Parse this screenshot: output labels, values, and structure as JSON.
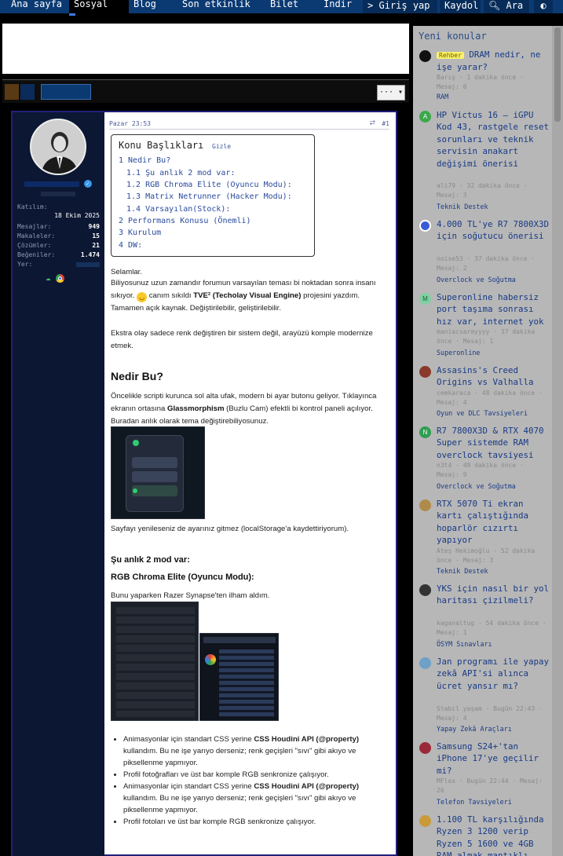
{
  "nav": {
    "home": "Ana sayfa",
    "social": "Sosyal",
    "blog": "Blog",
    "recent": "Son etkinlik",
    "ticket": "Bilet",
    "download": "İndir",
    "login": "Giriş yap",
    "register": "Kaydol",
    "search": "Ara"
  },
  "thread": {
    "more_label": "···"
  },
  "post": {
    "timestamp": "Pazar 23:53",
    "number": "#1",
    "author": {
      "joined_label": "Katılım:",
      "joined_value": "18 Ekim 2025",
      "stats": [
        {
          "label": "Mesajlar:",
          "value": "949"
        },
        {
          "label": "Makaleler:",
          "value": "15"
        },
        {
          "label": "Çözümler:",
          "value": "21"
        },
        {
          "label": "Beğeniler:",
          "value": "1.474"
        },
        {
          "label": "Yer:",
          "value": ""
        }
      ]
    },
    "toc": {
      "title": "Konu Başlıkları",
      "hide": "Gizle",
      "items": [
        "1 Nedir Bu?",
        "1.1 Şu anlık 2 mod var:",
        "1.2 RGB Chroma Elite (Oyuncu Modu):",
        "1.3 Matrix Netrunner (Hacker Modu):",
        "1.4 Varsayılan(Stock):",
        "2 Performans Konusu (Önemli)",
        "3 Kurulum",
        "4 DW:"
      ]
    },
    "p_greeting": "Selamlar.",
    "p1_a": "Biliyosunuz uzun zamandır forumun varsayılan teması bi noktadan sonra insanı sıkıyor. ",
    "p1_b": " canım sıkıldı ",
    "p1_bold": "TVE² (Techolay Visual Engine)",
    "p1_c": " projesini yazdım. Tamamen açık kaynak. Değiştirilebilir, geliştirilebilir.",
    "p2": "Ekstra olay sadece renk değiştiren bir sistem değil, arayüzü komple modernize etmek.",
    "h_nedir": "Nedir Bu?",
    "p3_a": "Öncelikle scripti kurunca sol alta ufak, modern bi ayar butonu geliyor. Tıklayınca ekranın ortasına ",
    "p3_bold": "Glassmorphism",
    "p3_b": " (Buzlu Cam) efektli bi kontrol paneli açılıyor. Buradan anlık olarak tema değiştirebiliyosunuz.",
    "p4": "Sayfayı yenileseniz de ayarınız gitmez (localStorage'a kaydettiriyorum).",
    "h_modes": "Şu anlık 2 mod var:",
    "h_rgb": "RGB Chroma Elite (Oyuncu Modu):",
    "p5": "Bunu yaparken Razer Synapse'ten ilham aldım.",
    "bullets": [
      {
        "a": "Animasyonlar için standart CSS yerine ",
        "bold": "CSS Houdini API (@property)",
        "b": " kullandım. Bu ne işe yarıyo derseniz; renk geçişleri \"sıvı\" gibi akıyo ve piksellenme yapmıyor."
      },
      {
        "a": "Profil fotoğrafları ve üst bar komple RGB senkronize çalışıyor.",
        "bold": "",
        "b": ""
      },
      {
        "a": "Animasyonlar için standart CSS yerine ",
        "bold": "CSS Houdini API (@property)",
        "b": " kullandım. Bu ne işe yarıyo derseniz; renk geçişleri \"sıvı\" gibi akıyo ve piksellenme yapmıyor."
      },
      {
        "a": "Profil fotoları ve üst bar komple RGB senkronize çalışıyor.",
        "bold": "",
        "b": ""
      }
    ]
  },
  "sidebar": {
    "title": "Yeni konular",
    "items": [
      {
        "avatar": "",
        "avatar_color": "#111111",
        "tag": "Rehber",
        "title": "DRAM nedir, ne işe yarar?",
        "meta": "Barış · 1 dakika önce · Mesaj: 0",
        "forum": "RAM"
      },
      {
        "avatar": "A",
        "avatar_color": "#3aa84a",
        "tag": "",
        "title": "HP Victus 16 – iGPU Kod 43, rastgele reset sorunları ve teknik servisin anakart değişimi önerisi",
        "meta": "ali79 · 32 dakika önce · Mesaj: 3",
        "forum": "Teknik Destek"
      },
      {
        "avatar": "",
        "avatar_color": "#3b5bd6",
        "tag": "",
        "title": "4.000 TL'ye R7 7800X3D için soğutucu önerisi",
        "meta": "noise53 · 37 dakika önce · Mesaj: 2",
        "forum": "Overclock ve Soğutma"
      },
      {
        "avatar": "M",
        "avatar_color": "#7fd0a0",
        "tag": "",
        "title": "Superonline habersiz port taşıma sonrası hız var, internet yok",
        "meta": "maniacsarmyyyy · 37 dakika önce · Mesaj: 1",
        "forum": "Superonline"
      },
      {
        "avatar": "",
        "avatar_color": "#8a3a2a",
        "tag": "",
        "title": "Assasins's Creed Origins vs Valhalla",
        "meta": "cemkaraca · 48 dakika önce · Mesaj: 4",
        "forum": "Oyun ve DLC Tavsiyeleri"
      },
      {
        "avatar": "N",
        "avatar_color": "#2e9e52",
        "tag": "",
        "title": "R7 7800X3D & RTX 4070 Super sistemde RAM overclock tavsiyesi",
        "meta": "n3t4 · 49 dakika önce · Mesaj: 9",
        "forum": "Overclock ve Soğutma"
      },
      {
        "avatar": "",
        "avatar_color": "#b08a4a",
        "tag": "",
        "title": "RTX 5070 Ti ekran kartı çalıştığında hoparlör cızırtı yapıyor",
        "meta": "Ateş Hekimoğlu · 52 dakika önce · Mesaj: 3",
        "forum": "Teknik Destek"
      },
      {
        "avatar": "",
        "avatar_color": "#333333",
        "tag": "",
        "title": "YKS için nasıl bir yol haritası çizilmeli?",
        "meta": "kaganaltug · 54 dakika önce · Mesaj: 1",
        "forum": "ÖSYM Sınavları"
      },
      {
        "avatar": "",
        "avatar_color": "#6fa0c8",
        "tag": "",
        "title": "Jan programı ile yapay zekâ API'si alınca ücret yansır mı?",
        "meta": "Stabil yaşam · Bugün 22:43 · Mesaj: 4",
        "forum": "Yapay Zekâ Araçları"
      },
      {
        "avatar": "",
        "avatar_color": "#9a2a3a",
        "tag": "",
        "title": "Samsung S24+'tan iPhone 17'ye geçilir mi?",
        "meta": "MFlex · Bugün 22:44 · Mesaj: 26",
        "forum": "Telefon Tavsiyeleri"
      },
      {
        "avatar": "",
        "avatar_color": "#c99a3a",
        "tag": "",
        "title": "1.100 TL karşılığında Ryzen 3 1200 verip Ryzen 5 1600 ve 4GB RAM almak mantıklı",
        "meta": "",
        "forum": ""
      }
    ]
  }
}
